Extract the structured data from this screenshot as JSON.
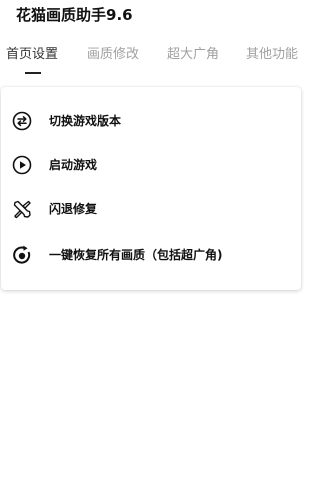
{
  "app": {
    "title": "花猫画质助手9.6"
  },
  "tabs": [
    {
      "label": "首页设置",
      "active": true
    },
    {
      "label": "画质修改",
      "active": false
    },
    {
      "label": "超大广角",
      "active": false
    },
    {
      "label": "其他功能",
      "active": false
    }
  ],
  "menu": {
    "items": [
      {
        "label": "切换游戏版本",
        "icon": "swap-icon"
      },
      {
        "label": "启动游戏",
        "icon": "play-circle-icon"
      },
      {
        "label": "闪退修复",
        "icon": "tools-icon"
      },
      {
        "label": "一键恢复所有画质（包括超广角)",
        "icon": "restore-icon"
      }
    ]
  },
  "colors": {
    "tab_active": "#333333",
    "tab_inactive": "#a0a0a0",
    "indicator": "#222222",
    "text": "#111111"
  }
}
